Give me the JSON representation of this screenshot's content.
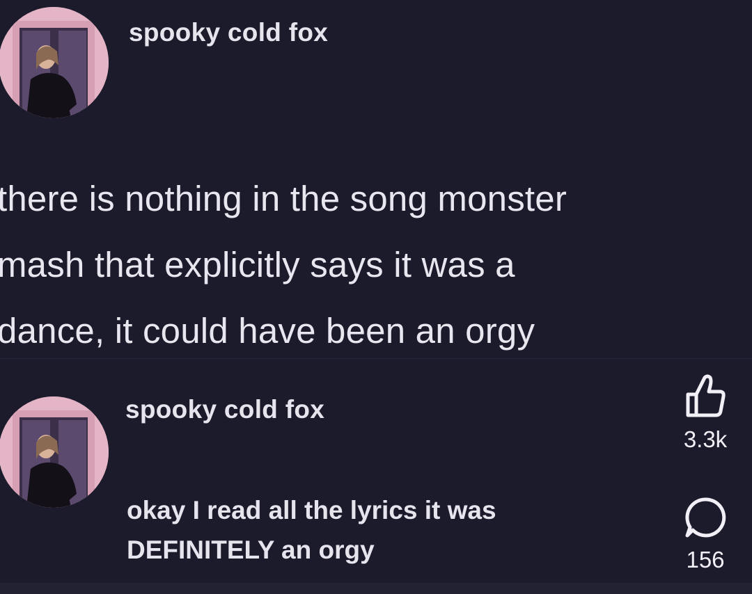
{
  "posts": [
    {
      "username": "spooky cold fox",
      "lines": [
        "there is nothing in the song monster",
        "mash that explicitly says it was a",
        "dance, it could have been an orgy"
      ]
    },
    {
      "username": "spooky cold fox",
      "lines": [
        "okay I read all the lyrics it was",
        "DEFINITELY an orgy"
      ]
    }
  ],
  "actions": {
    "like_icon": "thumbs-up-icon",
    "like_count": "3.3k",
    "comment_icon": "speech-bubble-icon",
    "comment_count": "156"
  },
  "colors": {
    "background": "#1c1b2c",
    "text": "#e8e6ee",
    "avatar_pink": "#e7b9c9"
  }
}
